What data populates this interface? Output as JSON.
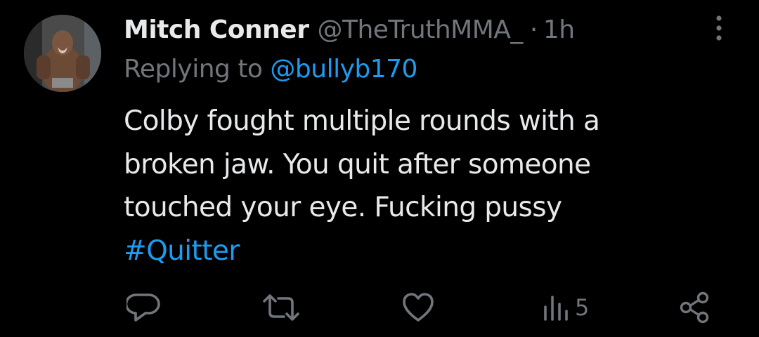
{
  "author": {
    "display_name": "Mitch Conner",
    "handle": "@TheTruthMMA_",
    "separator": "·",
    "time_ago": "1h"
  },
  "reply": {
    "prefix": "Replying to ",
    "to_handle": "@bullyb170"
  },
  "body": {
    "lines": [
      "Colby fought multiple rounds with a",
      "broken jaw. You quit after someone",
      "touched your eye. Fucking pussy"
    ],
    "hashtag": "#Quitter"
  },
  "actions": {
    "views_count": "5",
    "icons": [
      "reply-icon",
      "retweet-icon",
      "like-icon",
      "views-icon",
      "share-icon"
    ]
  },
  "colors": {
    "background": "#000000",
    "text": "#e7e9ea",
    "muted": "#71767b",
    "accent": "#1d9bf0"
  }
}
